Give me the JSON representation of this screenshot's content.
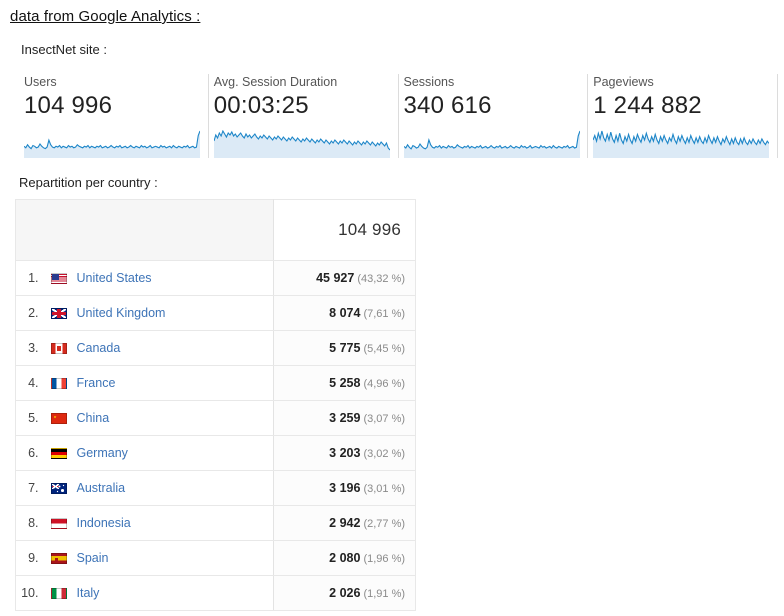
{
  "main_title": "data from Google Analytics :",
  "site_label": "InsectNet site :",
  "section_label": "Repartition per country :",
  "colors": {
    "link": "#3e74b7",
    "spark_line": "#1d86c8",
    "spark_fill": "#dceaf6",
    "header_bg": "#f6f6f6",
    "border": "#e8e8e8",
    "muted_text": "#8a8a8a"
  },
  "metrics": [
    {
      "label": "Users",
      "value": "104 996",
      "sparkline_name": "users-sparkline"
    },
    {
      "label": "Avg. Session Duration",
      "value": "00:03:25",
      "sparkline_name": "avg-session-duration-sparkline"
    },
    {
      "label": "Sessions",
      "value": "340 616",
      "sparkline_name": "sessions-sparkline"
    },
    {
      "label": "Pageviews",
      "value": "1 244 882",
      "sparkline_name": "pageviews-sparkline"
    }
  ],
  "country_table": {
    "total_label": "104 996",
    "rows": [
      {
        "rank": "1.",
        "flag": "flag-us",
        "country": "United States",
        "value": "45 927",
        "percent": "(43,32 %)"
      },
      {
        "rank": "2.",
        "flag": "flag-gb",
        "country": "United Kingdom",
        "value": "8 074",
        "percent": "(7,61 %)"
      },
      {
        "rank": "3.",
        "flag": "flag-ca",
        "country": "Canada",
        "value": "5 775",
        "percent": "(5,45 %)"
      },
      {
        "rank": "4.",
        "flag": "flag-fr",
        "country": "France",
        "value": "5 258",
        "percent": "(4,96 %)"
      },
      {
        "rank": "5.",
        "flag": "flag-cn",
        "country": "China",
        "value": "3 259",
        "percent": "(3,07 %)"
      },
      {
        "rank": "6.",
        "flag": "flag-de",
        "country": "Germany",
        "value": "3 203",
        "percent": "(3,02 %)"
      },
      {
        "rank": "7.",
        "flag": "flag-au",
        "country": "Australia",
        "value": "3 196",
        "percent": "(3,01 %)"
      },
      {
        "rank": "8.",
        "flag": "flag-id",
        "country": "Indonesia",
        "value": "2 942",
        "percent": "(2,77 %)"
      },
      {
        "rank": "9.",
        "flag": "flag-es",
        "country": "Spain",
        "value": "2 080",
        "percent": "(1,96 %)"
      },
      {
        "rank": "10.",
        "flag": "flag-it",
        "country": "Italy",
        "value": "2 026",
        "percent": "(1,91 %)"
      }
    ]
  },
  "chart_data": {
    "type": "line",
    "title": "Google Analytics metric sparklines",
    "xlabel": "",
    "ylabel": "",
    "grid": false,
    "legend": "none",
    "series": [
      {
        "name": "Users",
        "values": [
          14,
          12,
          16,
          13,
          11,
          15,
          14,
          12,
          13,
          17,
          14,
          12,
          11,
          13,
          22,
          16,
          13,
          12,
          14,
          13,
          15,
          12,
          14,
          13,
          12,
          15,
          13,
          14,
          12,
          13,
          16,
          14,
          13,
          12,
          14,
          13,
          15,
          12,
          14,
          13,
          12,
          14,
          13,
          15,
          12,
          13,
          14,
          12,
          13,
          15,
          13,
          12,
          14,
          13,
          15,
          12,
          13,
          14,
          12,
          13,
          15,
          13,
          12,
          14,
          13,
          12,
          15,
          13,
          14,
          12,
          13,
          15,
          12,
          13,
          14,
          13,
          12,
          15,
          13,
          14,
          12,
          13,
          14,
          12,
          15,
          13,
          12,
          14,
          13,
          12,
          14,
          13,
          15,
          12,
          13,
          14,
          12,
          13,
          28,
          34
        ]
      },
      {
        "name": "Avg. Session Duration",
        "values": [
          16,
          22,
          19,
          24,
          21,
          26,
          23,
          20,
          24,
          22,
          25,
          21,
          23,
          20,
          22,
          24,
          21,
          19,
          23,
          20,
          22,
          19,
          21,
          23,
          20,
          18,
          21,
          19,
          22,
          20,
          18,
          21,
          19,
          17,
          20,
          18,
          21,
          19,
          17,
          20,
          18,
          16,
          19,
          17,
          20,
          18,
          16,
          19,
          17,
          15,
          18,
          16,
          19,
          17,
          15,
          18,
          16,
          14,
          17,
          15,
          18,
          16,
          14,
          17,
          15,
          13,
          16,
          14,
          17,
          15,
          13,
          16,
          14,
          17,
          15,
          13,
          16,
          14,
          12,
          15,
          13,
          16,
          14,
          12,
          15,
          13,
          16,
          14,
          12,
          15,
          13,
          11,
          14,
          12,
          15,
          13,
          11,
          14,
          9,
          7
        ]
      },
      {
        "name": "Sessions",
        "values": [
          13,
          11,
          15,
          12,
          10,
          14,
          13,
          11,
          12,
          16,
          13,
          11,
          10,
          12,
          21,
          15,
          12,
          11,
          13,
          12,
          14,
          11,
          13,
          12,
          11,
          14,
          12,
          13,
          11,
          12,
          15,
          13,
          12,
          11,
          13,
          12,
          14,
          11,
          13,
          12,
          11,
          13,
          12,
          14,
          11,
          12,
          13,
          11,
          12,
          14,
          12,
          11,
          13,
          12,
          14,
          11,
          12,
          13,
          11,
          12,
          14,
          12,
          11,
          13,
          12,
          11,
          14,
          12,
          13,
          11,
          12,
          14,
          11,
          12,
          13,
          12,
          11,
          14,
          12,
          13,
          11,
          12,
          13,
          11,
          14,
          12,
          11,
          13,
          12,
          11,
          13,
          12,
          14,
          11,
          12,
          13,
          11,
          12,
          26,
          32
        ]
      },
      {
        "name": "Pageviews",
        "values": [
          15,
          19,
          14,
          21,
          16,
          23,
          17,
          14,
          20,
          15,
          22,
          16,
          13,
          19,
          14,
          21,
          15,
          12,
          18,
          14,
          20,
          15,
          12,
          18,
          14,
          20,
          16,
          13,
          19,
          15,
          21,
          16,
          13,
          18,
          14,
          20,
          15,
          12,
          18,
          14,
          19,
          15,
          12,
          17,
          14,
          20,
          15,
          12,
          18,
          14,
          19,
          15,
          12,
          17,
          13,
          19,
          15,
          12,
          17,
          13,
          18,
          14,
          12,
          17,
          13,
          19,
          15,
          12,
          17,
          13,
          18,
          14,
          11,
          16,
          13,
          18,
          14,
          11,
          16,
          12,
          17,
          13,
          11,
          16,
          12,
          17,
          13,
          11,
          15,
          12,
          16,
          13,
          11,
          15,
          12,
          16,
          13,
          11,
          14,
          12
        ]
      }
    ]
  }
}
